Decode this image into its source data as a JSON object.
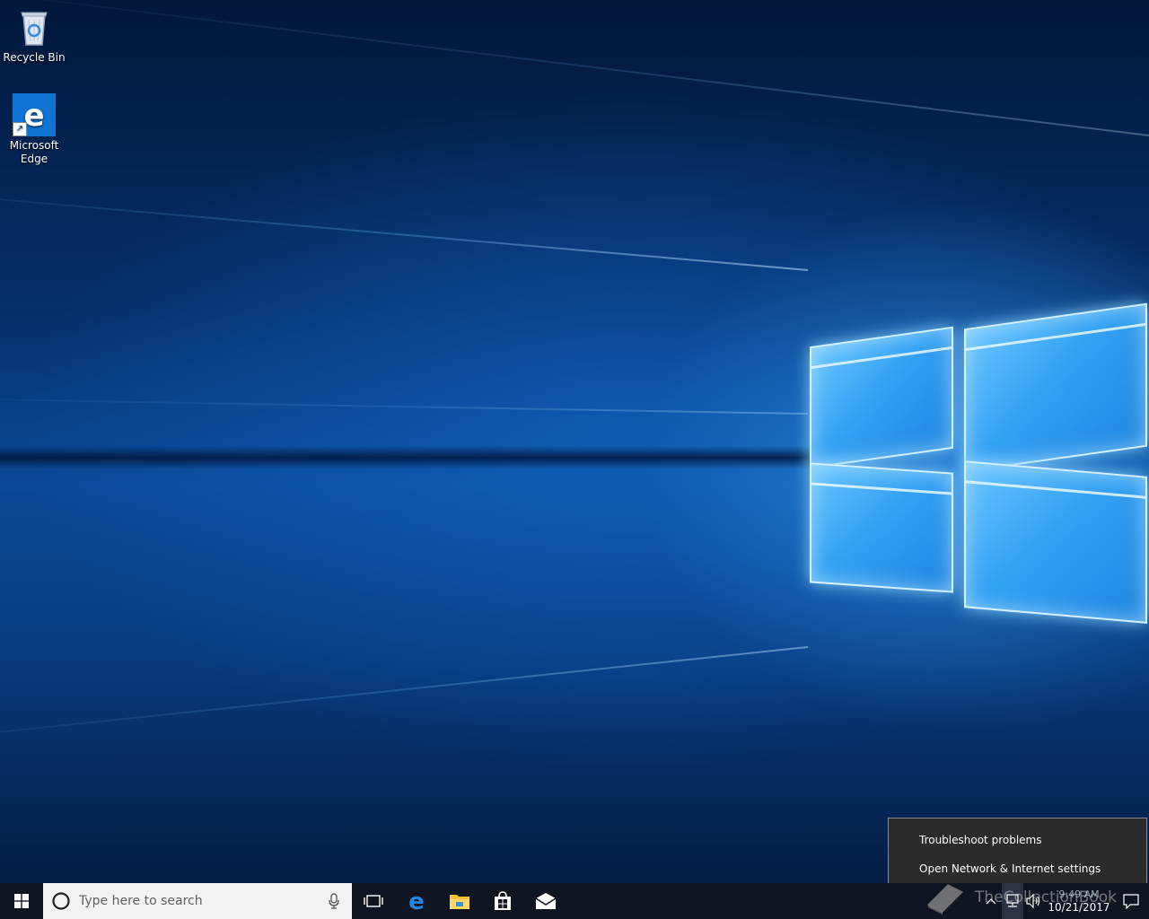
{
  "desktop": {
    "icons": [
      {
        "label": "Recycle Bin",
        "icon": "recycle-bin-icon"
      },
      {
        "label": "Microsoft\nEdge",
        "label_line1": "Microsoft",
        "label_line2": "Edge",
        "icon": "edge-icon"
      }
    ]
  },
  "context_menu": {
    "items": [
      {
        "label": "Troubleshoot problems"
      },
      {
        "label": "Open Network & Internet settings"
      }
    ]
  },
  "taskbar": {
    "search_placeholder": "Type here to search",
    "pinned": [
      "task-view-icon",
      "edge-icon",
      "file-explorer-icon",
      "store-icon",
      "mail-icon"
    ],
    "tray": {
      "date": "10/21/2017",
      "time": "9:49 AM"
    }
  },
  "watermark": {
    "text": "TheCollectionBook"
  },
  "colors": {
    "taskbar": "#101522",
    "accent": "#0f74d4",
    "menu_bg": "#2b2b2b"
  }
}
